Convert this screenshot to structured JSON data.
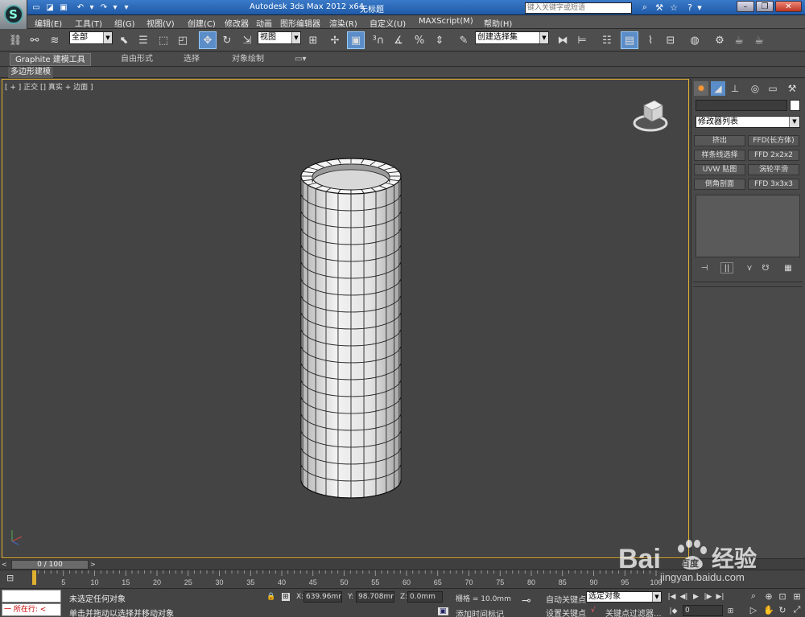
{
  "titlebar": {
    "app_title": "Autodesk 3ds Max  2012 x64",
    "file_name": "无标题",
    "search_placeholder": "键入关键字或短语",
    "logo": "3ds-max-logo-icon",
    "quick_access": [
      "new-file-icon",
      "open-file-icon",
      "save-icon",
      "undo-icon",
      "undo-dropdown-icon",
      "redo-icon",
      "redo-dropdown-icon",
      "customize-dropdown-icon"
    ],
    "tools": [
      "binoculars-icon",
      "tools-icon",
      "star-icon",
      "help-icon"
    ],
    "window_controls": [
      "minimize-icon",
      "restore-icon",
      "close-icon"
    ]
  },
  "menubar": {
    "items": [
      "编辑(E)",
      "工具(T)",
      "组(G)",
      "视图(V)",
      "创建(C)",
      "修改器",
      "动画",
      "图形编辑器",
      "渲染(R)",
      "自定义(U)",
      "MAXScript(M)",
      "帮助(H)"
    ]
  },
  "toolbar": {
    "filter_value": "全部",
    "refcoord_value": "视图",
    "named_sel_value": "创建选择集"
  },
  "ribbon": {
    "tabs": [
      "Graphite 建模工具",
      "自由形式",
      "选择",
      "对象绘制"
    ],
    "sub_label": "多边形建模"
  },
  "viewport": {
    "label": "[ + ] 正交 [] 真实 + 边面 ]"
  },
  "cmdpanel": {
    "modifier_list": "修改器列表",
    "buttons": [
      "挤出",
      "FFD(长方体)",
      "样条线选择",
      "FFD 2x2x2",
      "UVW 贴图",
      "涡轮平滑",
      "倒角剖面",
      "FFD 3x3x3"
    ]
  },
  "timeslider": {
    "value": "0 / 100",
    "ticks": [
      0,
      5,
      10,
      15,
      20,
      25,
      30,
      35,
      40,
      45,
      50,
      55,
      60,
      65,
      70,
      75,
      80,
      85,
      90,
      95,
      100
    ]
  },
  "status": {
    "running": "一  所在行:  <",
    "selection": "未选定任何对象",
    "hint": "单击并拖动以选择并移动对象",
    "x_label": "X:",
    "x_value": "639.96mm",
    "y_label": "Y:",
    "y_value": "98.708mm",
    "z_label": "Z:",
    "z_value": "0.0mm",
    "grid": "栅格 = 10.0mm",
    "add_time_tag": "添加时间标记",
    "auto_key": "自动关键点",
    "set_key": "设置关键点",
    "sel_obj": "选定对象",
    "key_filter": "关键点过滤器...",
    "frame": "0"
  },
  "watermark": {
    "brand": "Bai",
    "brand2": "百度",
    "suffix": "经验",
    "url": "jingyan.baidu.com"
  }
}
